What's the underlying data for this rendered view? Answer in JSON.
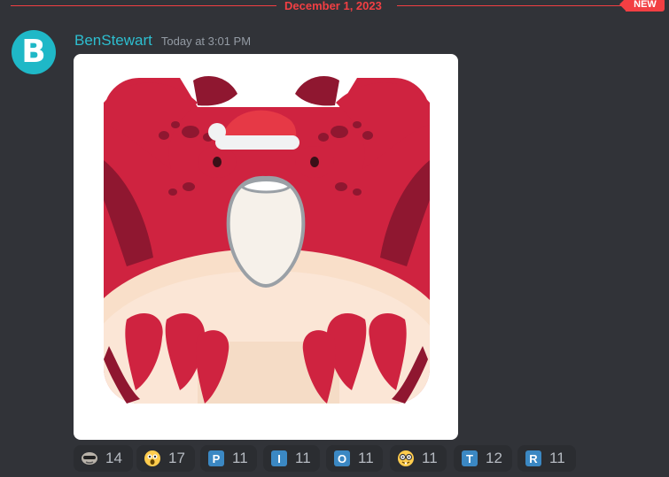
{
  "divider": {
    "date": "December 1, 2023",
    "badge": "NEW"
  },
  "message": {
    "avatar_letter": "B",
    "username": "BenStewart",
    "timestamp": "Today at 3:01 PM",
    "attachment_icon": "santa-crab-emoji-icon"
  },
  "reactions": [
    {
      "icon": "face-with-sunglasses-icon",
      "count": "14"
    },
    {
      "icon": "shocked-face-icon",
      "count": "17"
    },
    {
      "icon": "regional-indicator-p-icon",
      "letter": "P",
      "count": "11"
    },
    {
      "icon": "regional-indicator-i-icon",
      "letter": "I",
      "count": "11"
    },
    {
      "icon": "regional-indicator-o-icon",
      "letter": "O",
      "count": "11"
    },
    {
      "icon": "nerd-face-icon",
      "count": "11"
    },
    {
      "icon": "regional-indicator-t-icon",
      "letter": "T",
      "count": "12"
    },
    {
      "icon": "regional-indicator-r-icon",
      "letter": "R",
      "count": "11"
    }
  ],
  "colors": {
    "background": "#313338",
    "accent_red": "#f23f43",
    "username": "#2dbecf",
    "avatar": "#1fb8c7",
    "reaction_bg": "#2b2d31"
  }
}
